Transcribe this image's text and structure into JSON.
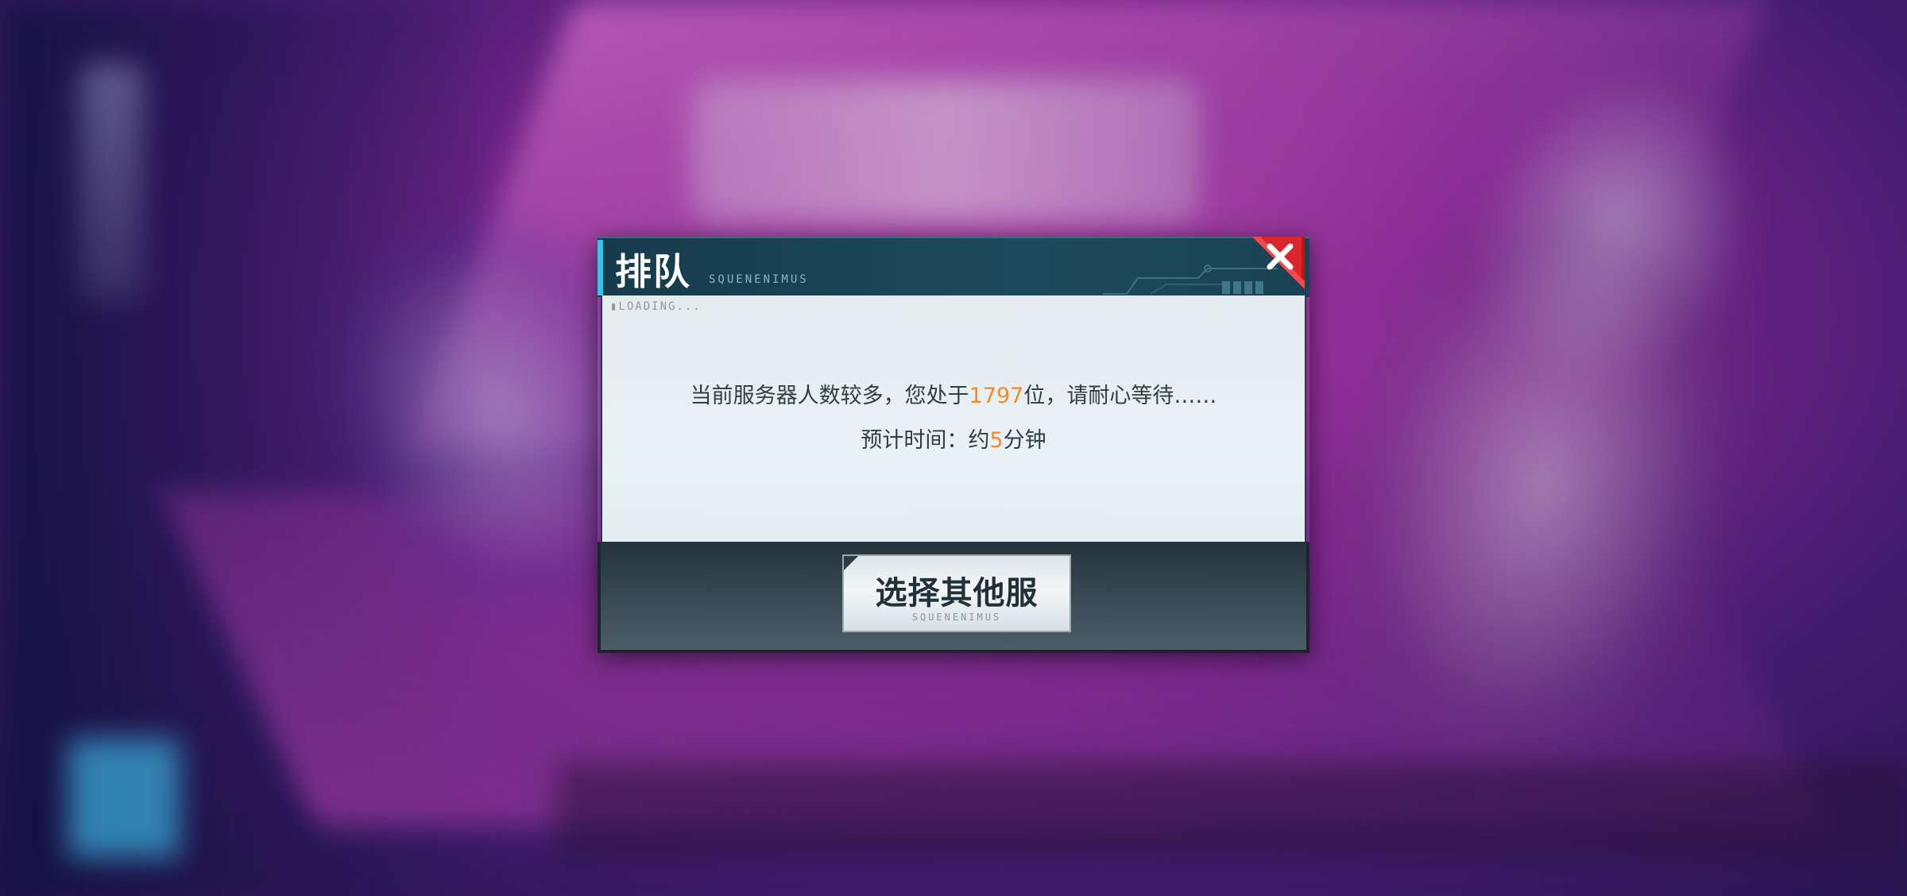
{
  "dialog": {
    "title": "排队",
    "subtitle": "SQUENENIMUS",
    "loading_label": "▮LOADING...",
    "message": {
      "line1_prefix": "当前服务器人数较多，您处于",
      "queue_position": "1797",
      "line1_suffix": "位，请耐心等待……",
      "line2_prefix": "预计时间：约",
      "wait_minutes": "5",
      "line2_suffix": "分钟"
    },
    "button": {
      "label": "选择其他服",
      "sub_label": "SQUENENIMUS"
    },
    "close_icon": "close-x-icon"
  },
  "colors": {
    "accent_cyan": "#32c5ea",
    "highlight_orange": "#f08a25",
    "close_red": "#d8262c"
  }
}
